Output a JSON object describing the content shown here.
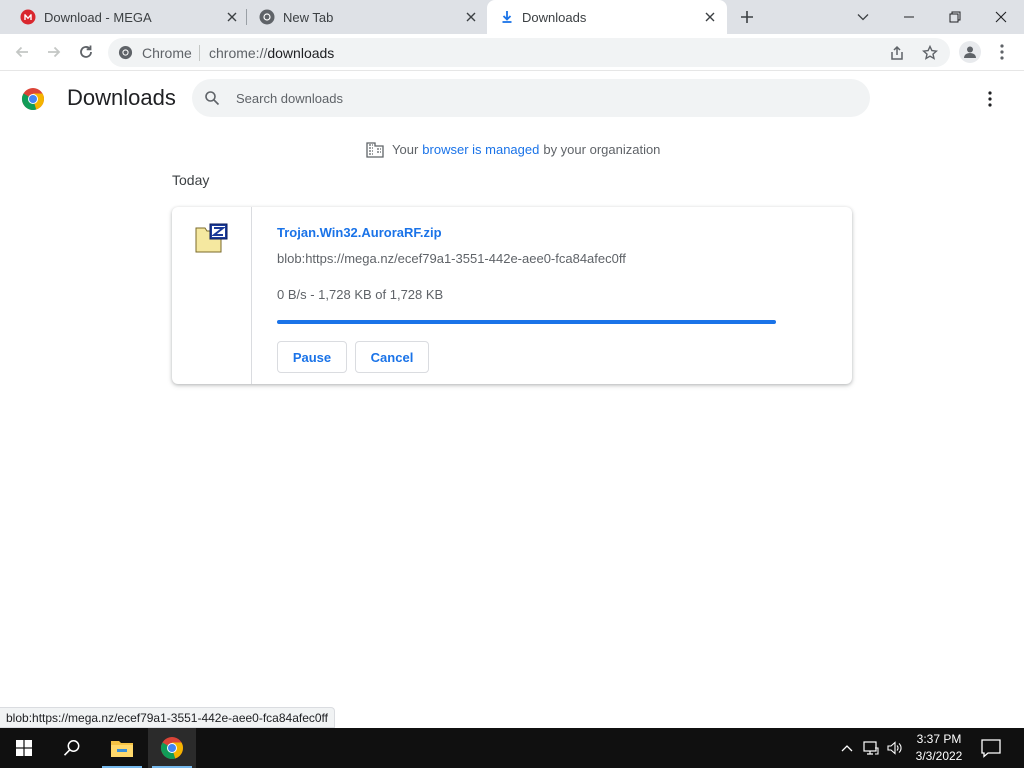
{
  "tabs": [
    {
      "title": "Download - MEGA",
      "icon": "mega-icon",
      "active": false
    },
    {
      "title": "New Tab",
      "icon": "chrome-icon",
      "active": false
    },
    {
      "title": "Downloads",
      "icon": "download-icon",
      "active": true
    }
  ],
  "toolbar": {
    "omnibox_label": "Chrome",
    "url_scheme": "chrome://",
    "url_path": "downloads"
  },
  "downloads": {
    "title": "Downloads",
    "search_placeholder": "Search downloads",
    "managed_prefix": "Your",
    "managed_link": "browser is managed",
    "managed_suffix": "by your organization",
    "date_group": "Today",
    "items": [
      {
        "file_name": "Trojan.Win32.AuroraRF.zip",
        "url": "blob:https://mega.nz/ecef79a1-3551-442e-aee0-fca84afec0ff",
        "status": "0 B/s - 1,728 KB of 1,728 KB",
        "progress": 1.0,
        "pause_label": "Pause",
        "cancel_label": "Cancel"
      }
    ]
  },
  "status_bubble": "blob:https://mega.nz/ecef79a1-3551-442e-aee0-fca84afec0ff",
  "taskbar": {
    "time": "3:37 PM",
    "date": "3/3/2022"
  },
  "colors": {
    "accent": "#1a73e8",
    "tabstrip": "#dee1e6",
    "taskbar": "#101010"
  }
}
